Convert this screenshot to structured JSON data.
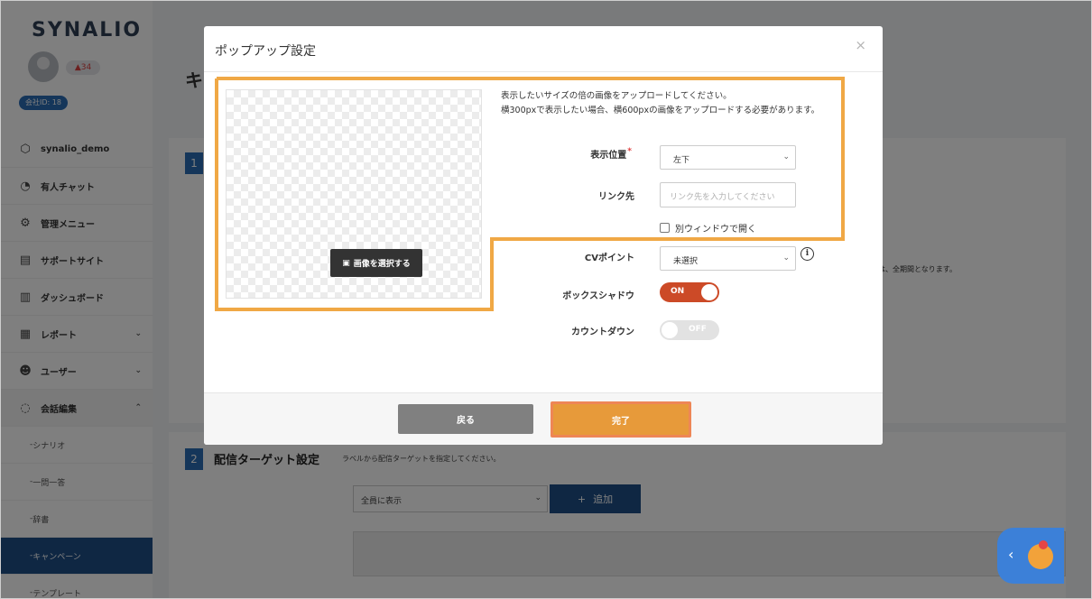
{
  "app": {
    "logo": "SYNALIO",
    "notification_count": "34",
    "company_id": "会社ID: 18",
    "page_title_char": "キ"
  },
  "sidebar": {
    "items": [
      {
        "label": "synalio_demo",
        "icon": "cube-icon"
      },
      {
        "label": "有人チャット",
        "icon": "headset-icon"
      },
      {
        "label": "管理メニュー",
        "icon": "gears-icon"
      },
      {
        "label": "サポートサイト",
        "icon": "monitor-icon"
      },
      {
        "label": "ダッシュボード",
        "icon": "bar-chart-icon"
      },
      {
        "label": "レポート",
        "icon": "report-icon"
      },
      {
        "label": "ユーザー",
        "icon": "users-icon"
      },
      {
        "label": "会話編集",
        "icon": "chat-icon"
      }
    ],
    "sub_items": [
      "シナリオ",
      "一問一答",
      "辞書",
      "キャンペーン",
      "テンプレート"
    ]
  },
  "main": {
    "section1_number": "1",
    "section1_note": "合は、全期間となります。",
    "section2_number": "2",
    "section2_title": "配信ターゲット設定",
    "section2_desc": "ラベルから配信ターゲットを指定してください。",
    "target_select_value": "全員に表示",
    "add_button_label": "追加",
    "add_button_icon": "+"
  },
  "modal": {
    "title": "ポップアップ設定",
    "close": "×",
    "select_image_label": "画像を選択する",
    "help_text_line1": "表示したいサイズの倍の画像をアップロードしてください。",
    "help_text_line2": "横300pxで表示したい場合、横600pxの画像をアップロードする必要があります。",
    "fields": {
      "position_label": "表示位置",
      "position_value": "左下",
      "link_label": "リンク先",
      "link_placeholder": "リンク先を入力してください",
      "new_window_label": "別ウィンドウで開く",
      "cv_label": "CVポイント",
      "cv_value": "未選択",
      "box_shadow_label": "ボックスシャドウ",
      "box_shadow_state": "ON",
      "countdown_label": "カウントダウン",
      "countdown_state": "OFF"
    },
    "back_label": "戻る",
    "done_label": "完了"
  },
  "colors": {
    "accent_blue": "#1e4e86",
    "toggle_on": "#cc4a27",
    "done_button": "#e79a3a",
    "highlight": "#f0a845"
  }
}
